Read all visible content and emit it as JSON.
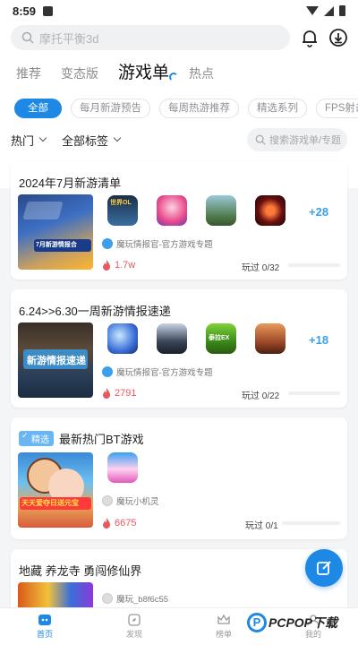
{
  "status_bar": {
    "time": "8:59"
  },
  "search": {
    "placeholder": "摩托平衡3d"
  },
  "tabs": [
    {
      "label": "推荐",
      "active": false
    },
    {
      "label": "变态版",
      "active": false
    },
    {
      "label": "游戏单",
      "active": true
    },
    {
      "label": "热点",
      "active": false
    }
  ],
  "chips": [
    "全部",
    "每月新游预告",
    "每周热游推荐",
    "精选系列",
    "FPS射击"
  ],
  "filters": {
    "sort": "热门",
    "tags": "全部标签",
    "search_placeholder": "搜索游戏单/专题"
  },
  "cards": [
    {
      "title": "2024年7月新游清单",
      "cover_text": "7月新游情报合",
      "more": "+28",
      "author": "魔玩情报官-官方游戏专题",
      "heat": "1.7w",
      "played": "玩过 0/32",
      "icon_label": "世界OL"
    },
    {
      "title": "6.24>>6.30一周新游情报速递",
      "cover_text": "新游情报速递",
      "more": "+18",
      "author": "魔玩情报官-官方游戏专题",
      "heat": "2791",
      "played": "玩过 0/22",
      "icon_label": "泰拉EX"
    },
    {
      "badge": "精选",
      "title": "最新热门BT游戏",
      "cover_text": "天天爱夺日送元宝",
      "author": "魔玩小机灵",
      "heat": "6675",
      "played": "玩过 0/1"
    },
    {
      "title": "地藏 养龙寺 勇闯修仙界",
      "author": "魔玩_b8f6c55"
    }
  ],
  "bottom_nav": [
    {
      "label": "首页",
      "active": true
    },
    {
      "label": "发现",
      "active": false
    },
    {
      "label": "榜单",
      "active": false
    },
    {
      "label": "我的",
      "active": false
    }
  ],
  "watermark": {
    "text": "PCPOP下载"
  },
  "colors": {
    "accent": "#1e88e5",
    "heat": "#e8595f",
    "more": "#39a0ea"
  }
}
